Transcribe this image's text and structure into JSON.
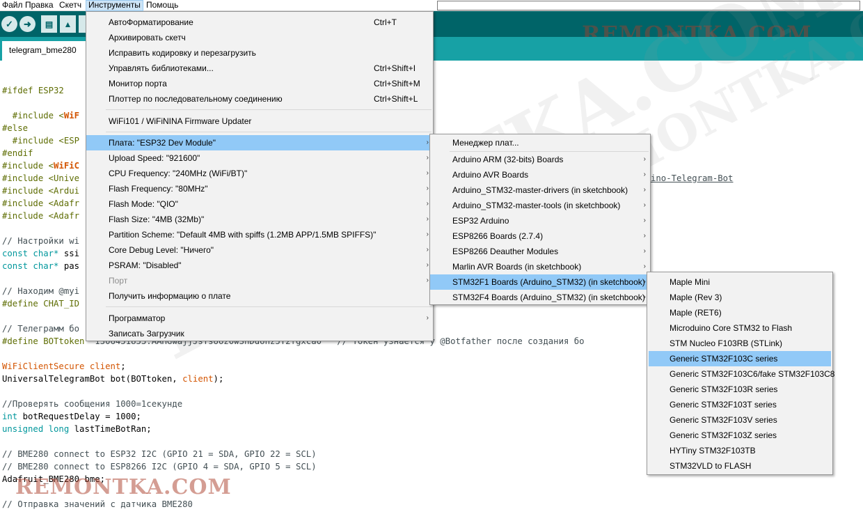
{
  "menubar": {
    "items": [
      "Файл",
      "Правка",
      "Скетч",
      "Инструменты",
      "Помощь"
    ]
  },
  "toolbar": {
    "verify_icon": "check-icon",
    "upload_icon": "arrow-right-icon",
    "new_icon": "file-icon",
    "open_icon": "arrow-up-icon",
    "watermark": "REMONTKA.COM"
  },
  "tabs": {
    "active": "telegram_bme280"
  },
  "editor": {
    "lines": {
      "l1": "#ifdef ESP32",
      "l2a": "  #include <",
      "l2b": "WiF",
      "l3": "#else",
      "l4": "  #include <ESP",
      "l5": "#endif",
      "l6a": "#include <",
      "l6b": "WiFiC",
      "l7": "#include <Unive",
      "l8": "#include <Ardui",
      "l9": "#include <Adafr",
      "l10": "#include <Adafr",
      "link": "ino-Telegram-Bot",
      "l11": "// Настройки wi",
      "l12a": "const char*",
      "l12b": " ssi",
      "l13a": "const char*",
      "l13b": " pas",
      "l14": "// Находим @myi",
      "l15": "#define CHAT_ID",
      "l16": "// Телеграмм бо",
      "l17a": "#define BOTtoken ",
      "l17b": "\"1306451853:AAHGwajjJsYsUoz0wSnDdonz5T2fgxca0\"",
      "l17c": "  // Токен узнается у @Botfather после создания бо",
      "l18a": "WiFiClientSecure",
      "l18b": " client",
      "l18c": ";",
      "l19a": "UniversalTelegramBot bot(BOTtoken, ",
      "l19b": "client",
      "l19c": ");",
      "l20": "//Проверять сообщения 1000=1секунде",
      "l21a": "int",
      "l21b": " botRequestDelay = 1000;",
      "l22a": "unsigned long",
      "l22b": " lastTimeBotRan;",
      "l23": "// BME280 connect to ESP32 I2C (GPIO 21 = SDA, GPIO 22 = SCL)",
      "l24": "// BME280 connect to ESP8266 I2C (GPIO 4 = SDA, GPIO 5 = SCL)",
      "l25": "Adafruit_BME280 bme;",
      "l26": "// Отправка значений с датчика BME280"
    },
    "watermark": "REMONTKA.COM"
  },
  "tools_menu": {
    "autoformat": {
      "label": "АвтоФорматирование",
      "shortcut": "Ctrl+T"
    },
    "archive": {
      "label": "Архивировать скетч"
    },
    "fix_encoding": {
      "label": "Исправить кодировку и перезагрузить"
    },
    "libraries": {
      "label": "Управлять библиотеками...",
      "shortcut": "Ctrl+Shift+I"
    },
    "serial_monitor": {
      "label": "Монитор порта",
      "shortcut": "Ctrl+Shift+M"
    },
    "serial_plotter": {
      "label": "Плоттер по последовательному соединению",
      "shortcut": "Ctrl+Shift+L"
    },
    "wifi_updater": {
      "label": "WiFi101 / WiFiNINA Firmware Updater"
    },
    "board": {
      "label": "Плата: \"ESP32 Dev Module\""
    },
    "upload_speed": {
      "label": "Upload Speed: \"921600\""
    },
    "cpu_freq": {
      "label": "CPU Frequency: \"240MHz (WiFi/BT)\""
    },
    "flash_freq": {
      "label": "Flash Frequency: \"80MHz\""
    },
    "flash_mode": {
      "label": "Flash Mode: \"QIO\""
    },
    "flash_size": {
      "label": "Flash Size: \"4MB (32Mb)\""
    },
    "partition": {
      "label": "Partition Scheme: \"Default 4MB with spiffs (1.2MB APP/1.5MB SPIFFS)\""
    },
    "debug_level": {
      "label": "Core Debug Level: \"Ничего\""
    },
    "psram": {
      "label": "PSRAM: \"Disabled\""
    },
    "port": {
      "label": "Порт"
    },
    "board_info": {
      "label": "Получить информацию о плате"
    },
    "programmer": {
      "label": "Программатор"
    },
    "burn_bootloader": {
      "label": "Записать Загрузчик"
    }
  },
  "boards_menu": {
    "manager": "Менеджер плат...",
    "arm": "Arduino ARM (32-bits) Boards",
    "avr": "Arduino AVR Boards",
    "stm32_drivers": "Arduino_STM32-master-drivers (in sketchbook)",
    "stm32_tools": "Arduino_STM32-master-tools (in sketchbook)",
    "esp32": "ESP32 Arduino",
    "esp8266": "ESP8266 Boards (2.7.4)",
    "deauther": "ESP8266 Deauther Modules",
    "marlin": "Marlin AVR Boards (in sketchbook)",
    "stm32f1": "STM32F1 Boards (Arduino_STM32) (in sketchbook)",
    "stm32f4": "STM32F4 Boards (Arduino_STM32) (in sketchbook)"
  },
  "stm32_menu": {
    "maple_mini": "Maple Mini",
    "maple_rev3": "Maple (Rev 3)",
    "maple_ret6": "Maple (RET6)",
    "microduino": "Microduino Core STM32 to Flash",
    "nucleo": "STM Nucleo F103RB (STLink)",
    "f103c": "Generic STM32F103C series",
    "f103c6": "Generic STM32F103C6/fake STM32F103C8",
    "f103r": "Generic STM32F103R series",
    "f103t": "Generic STM32F103T series",
    "f103v": "Generic STM32F103V series",
    "f103z": "Generic STM32F103Z series",
    "hytiny": "HYTiny STM32F103TB",
    "stm32vld": "STM32VLD to FLASH"
  },
  "colors": {
    "toolbar_bg": "#006468",
    "tabbar_bg": "#17a1a5",
    "menu_highlight": "#91c9f7"
  }
}
